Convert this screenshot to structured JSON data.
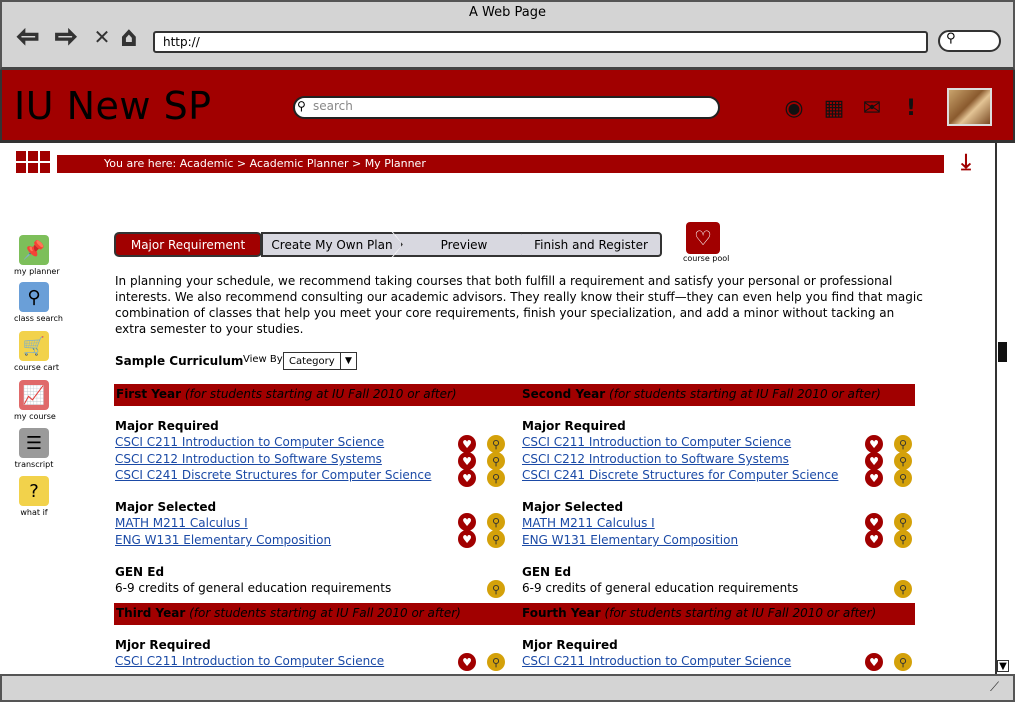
{
  "browser": {
    "window_title": "A Web Page",
    "url": "http://",
    "back_icon": "back-arrow-icon",
    "forward_icon": "forward-arrow-icon",
    "stop_icon": "close-icon",
    "home_icon": "home-icon"
  },
  "header": {
    "app_title": "IU New SP",
    "search_placeholder": "search",
    "icons": [
      "globe-icon",
      "calendar-icon",
      "mail-icon",
      "alert-icon"
    ],
    "brand_color": "#a10000"
  },
  "breadcrumb": {
    "text": "You are here: Academic > Academic Planner > My Planner"
  },
  "sidebar": {
    "items": [
      {
        "label": "my planner",
        "icon": "pin-icon",
        "color": "#7dbf5a"
      },
      {
        "label": "class search",
        "icon": "magnifier-icon",
        "color": "#6a9fd8"
      },
      {
        "label": "course cart",
        "icon": "cart-icon",
        "color": "#f2d24b"
      },
      {
        "label": "my course",
        "icon": "chart-icon",
        "color": "#e06a6a"
      },
      {
        "label": "transcript",
        "icon": "list-icon",
        "color": "#9a9a9a"
      },
      {
        "label": "what if",
        "icon": "question-icon",
        "color": "#f2d24b"
      }
    ]
  },
  "steps": [
    {
      "label": "Major Requirement",
      "active": true
    },
    {
      "label": "Create My Own Plan",
      "active": false
    },
    {
      "label": "Preview",
      "active": false
    },
    {
      "label": "Finish and Register",
      "active": false
    }
  ],
  "course_pool": {
    "label": "course pool"
  },
  "intro": "In planning your schedule, we recommend taking courses that both fulfill a requirement and satisfy your personal or professional interests. We also recommend consulting our academic advisors. They really know their stuff—they can even help you find that magic combination of classes that help you meet your core requirements, finish your specialization, and add a minor without tacking an extra semester to your studies.",
  "curriculum": {
    "title": "Sample Curriculum",
    "view_by_label": "View By",
    "view_by_value": "Category",
    "years": [
      {
        "name": "First Year",
        "note": "(for students starting at IU Fall 2010 or after)"
      },
      {
        "name": "Second Year",
        "note": "(for students starting at IU Fall 2010 or after)"
      },
      {
        "name": "Third Year",
        "note": "(for students starting at IU Fall 2010 or after)"
      },
      {
        "name": "Fourth Year",
        "note": "(for students starting at IU Fall 2010 or after)"
      }
    ],
    "major_required": "Major Required",
    "major_required_alt": "Mjor Required",
    "major_selected": "Major Selected",
    "gen_ed": "GEN Ed",
    "gen_ed_text": "6-9 credits of general education requirements",
    "required_courses": [
      "CSCI C211 Introduction to Computer Science",
      "CSCI C212 Introduction to Software Systems",
      "CSCI C241 Discrete Structures for Computer Science"
    ],
    "selected_courses": [
      "MATH M211 Calculus I",
      "ENG W131 Elementary Composition"
    ]
  }
}
